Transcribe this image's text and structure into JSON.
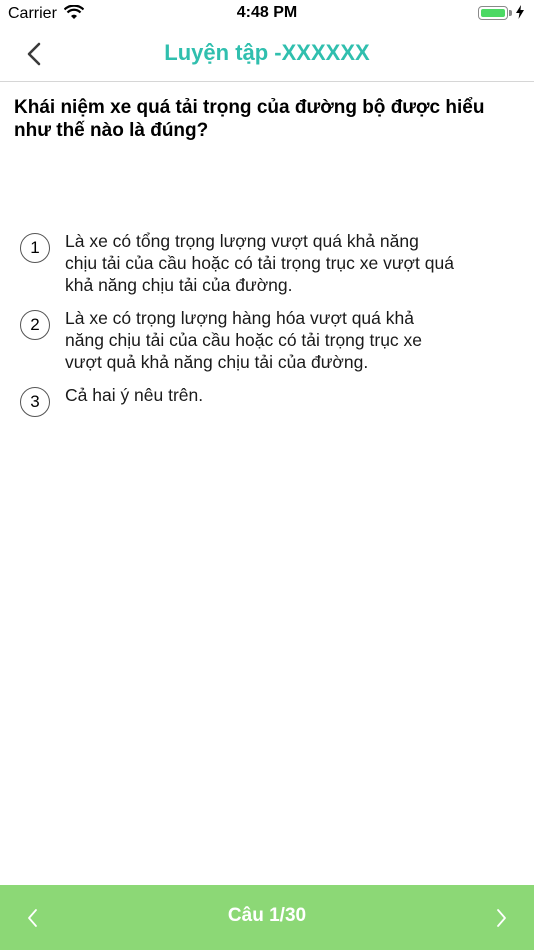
{
  "status_bar": {
    "carrier": "Carrier",
    "time": "4:48 PM",
    "battery_level": 1.0
  },
  "nav": {
    "title": "Luyện tập -XXXXXX",
    "back_icon": "chevron-left-icon"
  },
  "question": {
    "text": "Khái niệm xe quá tải trọng của đường bộ được hiểu như thế nào là đúng?"
  },
  "options": [
    {
      "number": "1",
      "text": "Là xe có tổng trọng lượng vượt quá khả năng chịu tải của cầu hoặc có tải trọng trục xe vượt quá khả năng chịu tải của đường."
    },
    {
      "number": "2",
      "text": "Là xe có trọng lượng hàng hóa vượt quá khả năng chịu tải của cầu hoặc có tải trọng trục xe vượt quả khả năng chịu tải của đường."
    },
    {
      "number": "3",
      "text": "Cả hai ý nêu trên."
    }
  ],
  "bottom_bar": {
    "counter": "Câu 1/30",
    "prev_icon": "chevron-left-icon",
    "next_icon": "chevron-right-icon"
  },
  "colors": {
    "accent": "#30bfae",
    "bottom_bar": "#8cd876",
    "battery": "#4cd964"
  }
}
